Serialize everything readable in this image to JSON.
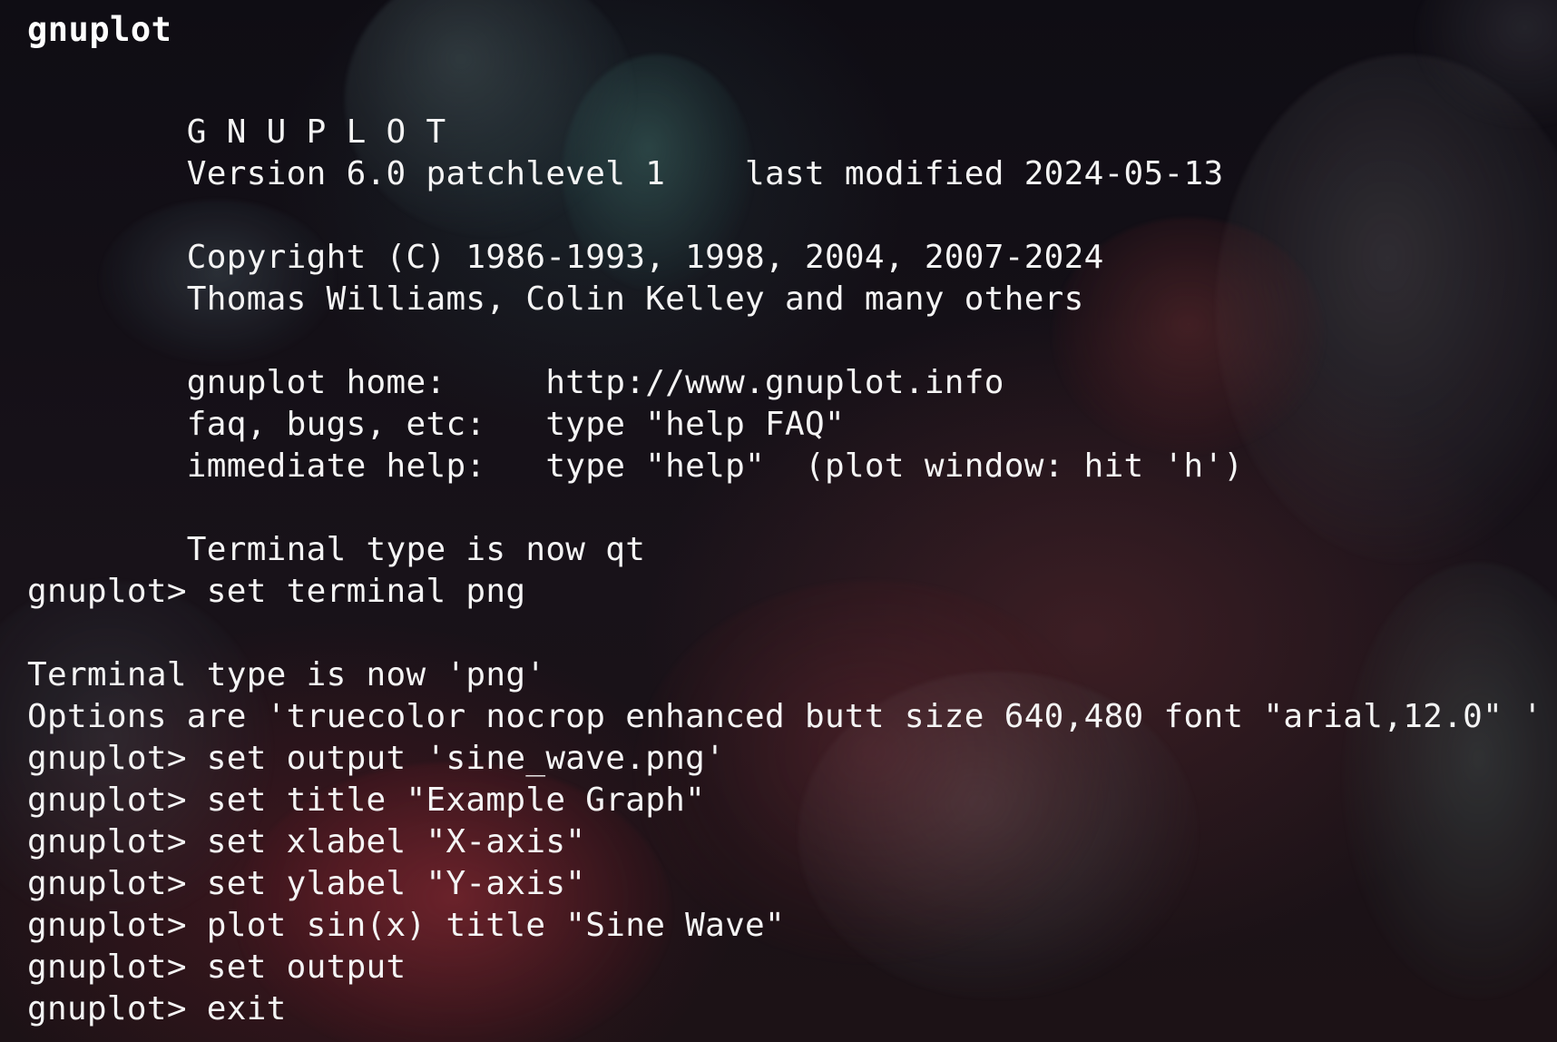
{
  "terminal": {
    "title": "gnuplot",
    "lines": [
      "        G N U P L O T",
      "        Version 6.0 patchlevel 1    last modified 2024-05-13",
      "",
      "        Copyright (C) 1986-1993, 1998, 2004, 2007-2024",
      "        Thomas Williams, Colin Kelley and many others",
      "",
      "        gnuplot home:     http://www.gnuplot.info",
      "        faq, bugs, etc:   type \"help FAQ\"",
      "        immediate help:   type \"help\"  (plot window: hit 'h')",
      "",
      "        Terminal type is now qt",
      "gnuplot> set terminal png",
      "",
      "Terminal type is now 'png'",
      "Options are 'truecolor nocrop enhanced butt size 640,480 font \"arial,12.0\" '",
      "gnuplot> set output 'sine_wave.png'",
      "gnuplot> set title \"Example Graph\"",
      "gnuplot> set xlabel \"X-axis\"",
      "gnuplot> set ylabel \"Y-axis\"",
      "gnuplot> plot sin(x) title \"Sine Wave\"",
      "gnuplot> set output",
      "gnuplot> exit"
    ]
  },
  "colors": {
    "background": "#120f17",
    "text": "#f4f4f4",
    "title": "#ffffff"
  }
}
